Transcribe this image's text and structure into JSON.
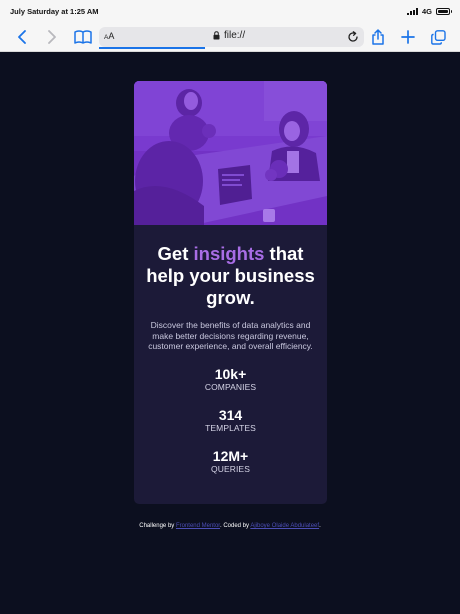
{
  "status_bar": {
    "time": "July Saturday at 1:25 AM",
    "network": "4G"
  },
  "toolbar": {
    "text_size": "AA",
    "url": "file://"
  },
  "card": {
    "headline_pre": "Get ",
    "headline_accent": "insights",
    "headline_post": " that help your business grow.",
    "description": "Discover the benefits of data analytics and make better decisions regarding revenue, customer experience, and overall efficiency.",
    "stats": [
      {
        "value": "10k+",
        "label": "COMPANIES"
      },
      {
        "value": "314",
        "label": "TEMPLATES"
      },
      {
        "value": "12M+",
        "label": "QUERIES"
      }
    ]
  },
  "attribution": {
    "prefix": "Challenge by ",
    "link1": "Frontend Mentor",
    "middle": ". Coded by ",
    "link2": "Ajiboye Olaide Abdulateef",
    "suffix": "."
  },
  "colors": {
    "page_bg": "#0c0f1f",
    "card_bg": "#1c1a38",
    "accent": "#a86de5",
    "link": "#4c4eb5",
    "toolbar_blue": "#1b74e8"
  }
}
